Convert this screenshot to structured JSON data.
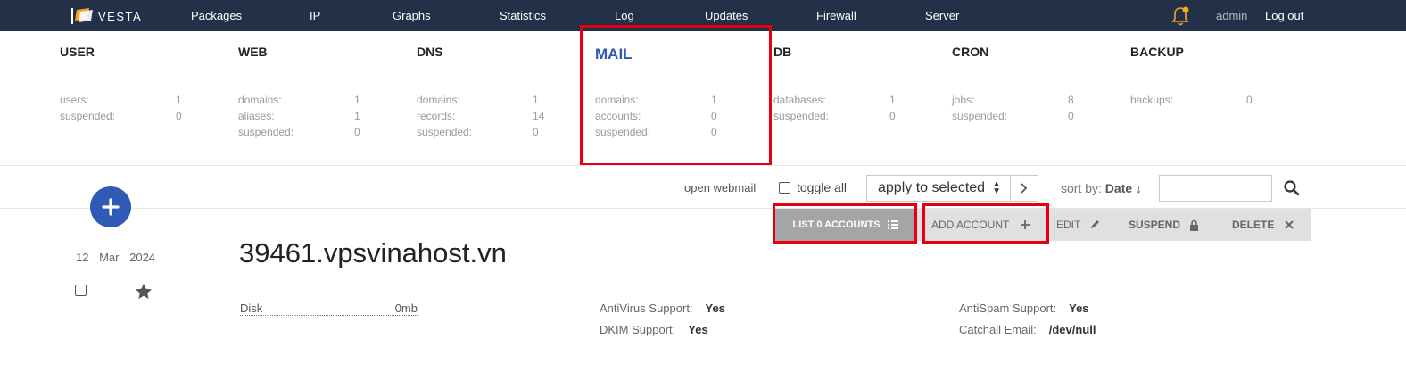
{
  "header": {
    "logo_text": "VESTA",
    "nav": [
      "Packages",
      "IP",
      "Graphs",
      "Statistics",
      "Log",
      "Updates",
      "Firewall",
      "Server"
    ],
    "user": "admin",
    "logout": "Log out"
  },
  "stats": {
    "user": {
      "title": "USER",
      "rows": [
        {
          "k": "users:",
          "v": "1"
        },
        {
          "k": "suspended:",
          "v": "0"
        }
      ]
    },
    "web": {
      "title": "WEB",
      "rows": [
        {
          "k": "domains:",
          "v": "1"
        },
        {
          "k": "aliases:",
          "v": "1"
        },
        {
          "k": "suspended:",
          "v": "0"
        }
      ]
    },
    "dns": {
      "title": "DNS",
      "rows": [
        {
          "k": "domains:",
          "v": "1"
        },
        {
          "k": "records:",
          "v": "14"
        },
        {
          "k": "suspended:",
          "v": "0"
        }
      ]
    },
    "mail": {
      "title": "MAIL",
      "rows": [
        {
          "k": "domains:",
          "v": "1"
        },
        {
          "k": "accounts:",
          "v": "0"
        },
        {
          "k": "suspended:",
          "v": "0"
        }
      ]
    },
    "db": {
      "title": "DB",
      "rows": [
        {
          "k": "databases:",
          "v": "1"
        },
        {
          "k": "suspended:",
          "v": "0"
        }
      ]
    },
    "cron": {
      "title": "CRON",
      "rows": [
        {
          "k": "jobs:",
          "v": "8"
        },
        {
          "k": "suspended:",
          "v": "0"
        }
      ]
    },
    "backup": {
      "title": "BACKUP",
      "rows": [
        {
          "k": "backups:",
          "v": "0"
        }
      ]
    }
  },
  "toolbar": {
    "open_webmail": "open webmail",
    "toggle_all": "toggle all",
    "apply_select": "apply to selected",
    "sort_label": "sort by:",
    "sort_value": "Date ↓"
  },
  "actions": {
    "list": "LIST 0 ACCOUNTS",
    "add": "ADD ACCOUNT",
    "edit": "EDIT",
    "suspend": "SUSPEND",
    "delete": "DELETE"
  },
  "record": {
    "date_day": "12",
    "date_month": "Mar",
    "date_year": "2024",
    "domain": "39461.vpsvinahost.vn",
    "disk_label": "Disk",
    "disk_value": "0mb",
    "antivirus_label": "AntiVirus Support:",
    "antivirus_value": "Yes",
    "dkim_label": "DKIM Support:",
    "dkim_value": "Yes",
    "antispam_label": "AntiSpam Support:",
    "antispam_value": "Yes",
    "catchall_label": "Catchall Email:",
    "catchall_value": "/dev/null"
  },
  "colors": {
    "topbar": "#233148",
    "accent": "#2f5bb7",
    "highlight": "#e3000f",
    "bell": "#f5a623"
  }
}
